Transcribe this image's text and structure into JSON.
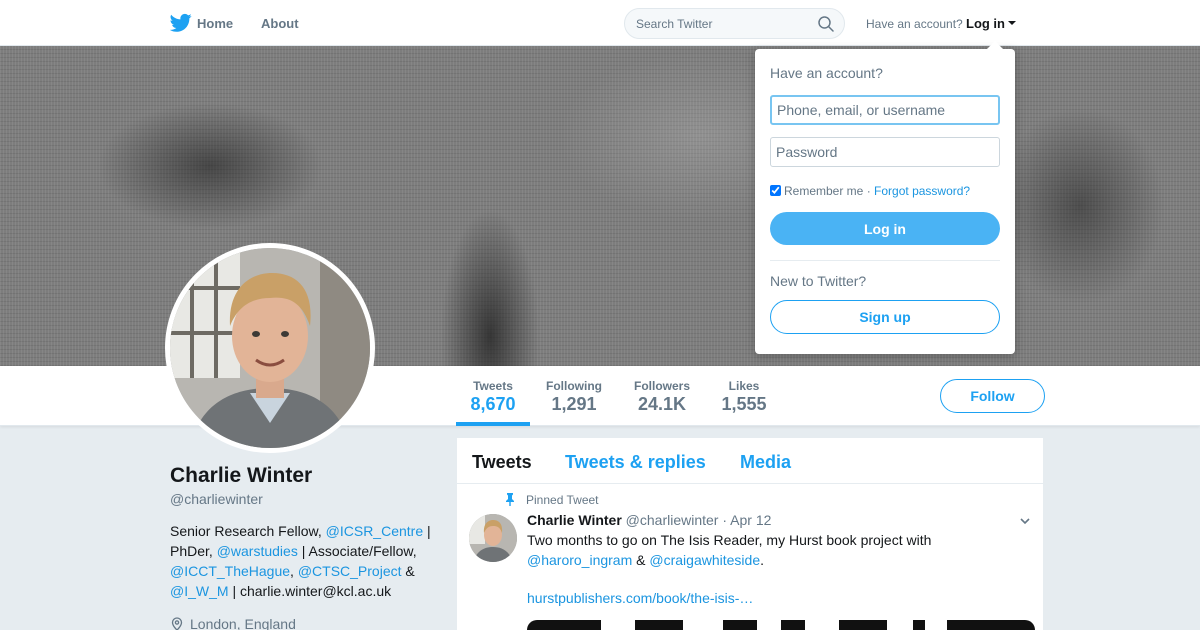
{
  "nav": {
    "logo_icon": "twitter-bird-icon",
    "home_label": "Home",
    "about_label": "About",
    "search_placeholder": "Search Twitter",
    "have_account_text": "Have an account?",
    "login_label": "Log in",
    "brand_color": "#1da1f2"
  },
  "login_dropdown": {
    "title": "Have an account?",
    "username_placeholder": "Phone, email, or username",
    "username_value": "",
    "password_placeholder": "Password",
    "remember_label": "Remember me",
    "separator": "·",
    "forgot_label": "Forgot password?",
    "remember_checked": true,
    "login_button": "Log in",
    "new_to_twitter": "New to Twitter?",
    "signup_button": "Sign up"
  },
  "profile": {
    "name": "Charlie Winter",
    "handle": "@charliewinter",
    "bio": [
      {
        "t": "Senior Research Fellow, ",
        "m": false
      },
      {
        "t": "@ICSR_Centre",
        "m": true
      },
      {
        "t": " | PhDer, ",
        "m": false
      },
      {
        "t": "@warstudies",
        "m": true
      },
      {
        "t": " | Associate/Fellow, ",
        "m": false
      },
      {
        "t": "@ICCT_TheHague",
        "m": true
      },
      {
        "t": ", ",
        "m": false
      },
      {
        "t": "@CTSC_Project",
        "m": true
      },
      {
        "t": " & ",
        "m": false
      },
      {
        "t": "@I_W_M",
        "m": true
      },
      {
        "t": " | charlie.winter@kcl.ac.uk",
        "m": false
      }
    ],
    "location": "London, England",
    "follow_button": "Follow"
  },
  "stats": [
    {
      "label": "Tweets",
      "value": "8,670",
      "active": true
    },
    {
      "label": "Following",
      "value": "1,291",
      "active": false
    },
    {
      "label": "Followers",
      "value": "24.1K",
      "active": false
    },
    {
      "label": "Likes",
      "value": "1,555",
      "active": false
    }
  ],
  "timeline": {
    "tabs": [
      "Tweets",
      "Tweets & replies",
      "Media"
    ],
    "pinned_label": "Pinned Tweet",
    "tweet": {
      "name": "Charlie Winter",
      "handle": "@charliewinter",
      "separator": "·",
      "date": "Apr 12",
      "text_before": "Two months to go on The Isis Reader, my Hurst book project with ",
      "mention1": "@haroro_ingram",
      "text_mid": " & ",
      "mention2": "@craigawhiteside",
      "text_end": ".",
      "link": "hurstpublishers.com/book/the-isis-…"
    }
  }
}
